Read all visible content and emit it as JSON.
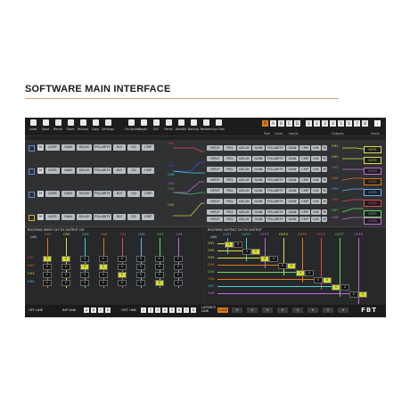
{
  "page": {
    "heading": "SOFTWARE MAIN INTERFACE",
    "accent": "#e8a070"
  },
  "toolbar": {
    "buttons": [
      {
        "label": "Load",
        "icon": "folder-icon"
      },
      {
        "label": "Save",
        "icon": "save-icon"
      },
      {
        "label": "Recall",
        "icon": "recall-icon"
      },
      {
        "label": "Store",
        "icon": "store-icon"
      },
      {
        "label": "Factory",
        "icon": "factory-icon"
      },
      {
        "label": "Copy",
        "icon": "copy-icon"
      },
      {
        "label": "Settings",
        "icon": "gear-icon"
      },
      {
        "label": "Fw Update",
        "icon": "firmware-update-icon"
      },
      {
        "label": "Login",
        "icon": "lock-icon"
      },
      {
        "label": "OLF",
        "icon": "lock-icon"
      },
      {
        "label": "Panel",
        "icon": "lock-icon"
      },
      {
        "label": "Identify",
        "icon": "identify-icon"
      },
      {
        "label": "Backup",
        "icon": "download-icon"
      },
      {
        "label": "Restore",
        "icon": "upload-icon"
      },
      {
        "label": "Sys Gen",
        "icon": "grid-icon"
      }
    ],
    "groups": {
      "first": "Pool",
      "second": "Level",
      "third": "Inputs",
      "fourth": "Outputs",
      "fifth": "Interf."
    },
    "selector_keys": [
      "R",
      "A",
      "B",
      "C",
      "D",
      "1",
      "2",
      "3",
      "4",
      "5",
      "6",
      "7",
      "8"
    ],
    "selector_active": "R",
    "info_key": "i"
  },
  "channels": {
    "input_row_buttons": [
      "M",
      "GATE",
      "GAIN",
      "DELAY",
      "POLARITY",
      "DLF",
      "EQ",
      "CMP"
    ],
    "output_row_buttons": [
      "HP/LP",
      "PEQ",
      "DELAY",
      "GAIN",
      "POLARITY",
      "GAIN",
      "CMP",
      "LIM",
      "M"
    ],
    "input_labels": [
      "CH1",
      "CH2",
      "CH3",
      "CH4",
      "CH5",
      "CH6"
    ],
    "output_labels": [
      "CH1",
      "CH2",
      "CH3",
      "CH4",
      "CH5",
      "CH6",
      "CH7",
      "CH8"
    ],
    "outputs": [
      "OUT1",
      "OUT2",
      "OUT3",
      "OUT4",
      "OUT5",
      "OUT6",
      "OUT7",
      "OUT8"
    ]
  },
  "routing_in": {
    "title": "ROUTING INPUT CH TO OUTPUT CH",
    "db_label": "(dB)",
    "cols": [
      {
        "label": "CH1",
        "color": "#e07a1a"
      },
      {
        "label": "CH2",
        "color": "#e0e04a"
      },
      {
        "label": "CH3",
        "color": "#4ad0d8"
      },
      {
        "label": "CH4",
        "color": "#e07a1a"
      },
      {
        "label": "CH5",
        "color": "#e04a4a"
      },
      {
        "label": "CH6",
        "color": "#6ab0ff"
      },
      {
        "label": "CH7",
        "color": "#66dd66"
      },
      {
        "label": "CH8",
        "color": "#c36ad8"
      }
    ],
    "rows": [
      {
        "label": "CH1",
        "color": "#e04a4a"
      },
      {
        "label": "CH2",
        "color": "#e07a1a"
      },
      {
        "label": "CH3",
        "color": "#e0e04a"
      },
      {
        "label": "CH4",
        "color": "#4ad0d8"
      }
    ],
    "cell_value": "0"
  },
  "routing_out": {
    "title": "ROUTING OUTPUT CH TO OUTPUT",
    "db_label": "(dB)",
    "cols": [
      {
        "label": "OUT1",
        "color": "#6ab0ff"
      },
      {
        "label": "OUT2",
        "color": "#4ad0d8"
      },
      {
        "label": "OUT3",
        "color": "#c36ad8"
      },
      {
        "label": "OUT4",
        "color": "#e0e04a"
      },
      {
        "label": "OUT5",
        "color": "#e07a1a"
      },
      {
        "label": "OUT6",
        "color": "#e04a4a"
      },
      {
        "label": "OUT7",
        "color": "#66dd66"
      },
      {
        "label": "OUT8",
        "color": "#c36ad8"
      }
    ],
    "rows": [
      {
        "label": "CH1",
        "color": "#e0e04a"
      },
      {
        "label": "CH2",
        "color": "#e0e04a"
      },
      {
        "label": "CH3",
        "color": "#e0e04a"
      },
      {
        "label": "CH4",
        "color": "#e07a1a"
      },
      {
        "label": "CH5",
        "color": "#66dd66"
      },
      {
        "label": "CH6",
        "color": "#e07a1a"
      },
      {
        "label": "CH7",
        "color": "#4ad0d8"
      },
      {
        "label": "CH8",
        "color": "#c36ad8"
      }
    ],
    "cell_value": "0"
  },
  "footer": {
    "off_line": "OFF LINE",
    "inp_link": "INP LINK",
    "inp_keys": [
      "A",
      "B",
      "C",
      "D"
    ],
    "out_link": "OUT LINK",
    "out_keys": [
      "1",
      "2",
      "3",
      "4",
      "5",
      "6",
      "7",
      "8"
    ],
    "latency_label": "LATENCY LINK",
    "latency_value": "0.000",
    "latency_keys": [
      "0",
      "0",
      "0",
      "0",
      "0",
      "0",
      "0",
      "0"
    ],
    "brand": "FBT"
  }
}
